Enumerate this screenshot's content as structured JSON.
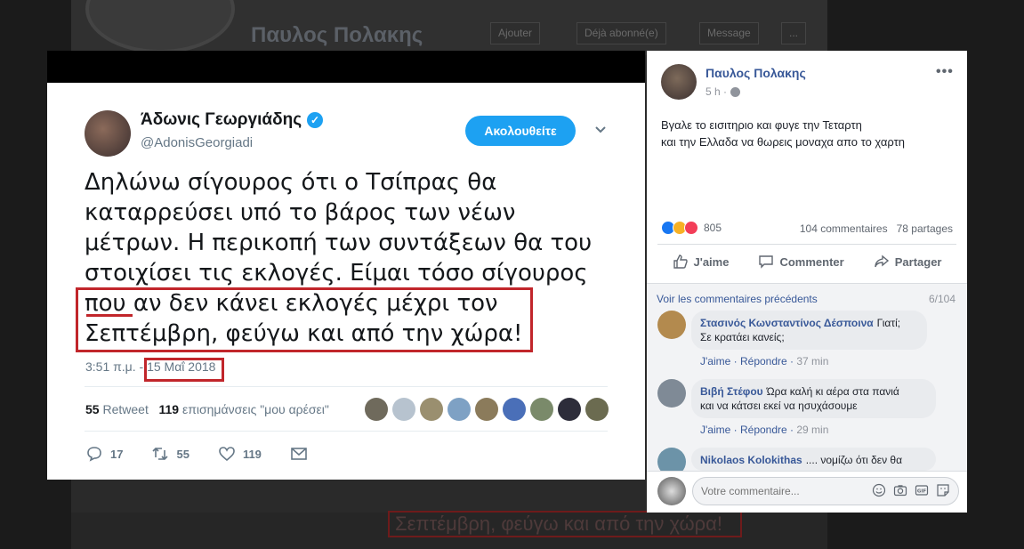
{
  "background": {
    "profile_name": "Παυλος Πολακης",
    "buttons": [
      "Ajouter",
      "Déjà abonné(e)",
      "Message",
      "..."
    ],
    "echo_text": "Σεπτέμβρη, φεύγω και από την χώρα!"
  },
  "tweet": {
    "author_name": "Άδωνις Γεωργιάδης",
    "handle": "@AdonisGeorgiadi",
    "follow_label": "Ακολουθείτε",
    "text_lines": [
      "Δηλώνω σίγουρος ότι ο Τσίπρας θα",
      "καταρρεύσει υπό το βάρος των νέων",
      "μέτρων. Η περικοπή των συντάξεων θα του",
      "στοιχίσει τις εκλογές. Είμαι τόσο σίγουρος",
      "που αν δεν κάνει εκλογές μέχρι τον",
      "Σεπτέμβρη, φεύγω και από την χώρα!"
    ],
    "timestamp": "3:51 π.μ. - 15 Μαΐ 2018",
    "retweets_count": "55",
    "retweets_label": "Retweet",
    "likes_count": "119",
    "likes_label": "επισημάνσεις \"μου αρέσει\"",
    "replies": "17",
    "retweet_action_count": "55",
    "like_action_count": "119"
  },
  "fb": {
    "author": "Παυλος Πολακης",
    "time": "5 h ·",
    "post_lines": [
      "Βγαλε το εισιτηριο και φυγε την Τεταρτη",
      "και την Ελλαδα να θωρεις μοναχα απο το χαρτη"
    ],
    "reaction_count": "805",
    "comments_count": "104 commentaires",
    "shares_count": "78 partages",
    "actions": {
      "like": "J'aime",
      "comment": "Commenter",
      "share": "Partager"
    },
    "view_previous": "Voir les commentaires précédents",
    "comment_position": "6/104",
    "comments": [
      {
        "author": "Στασινός Κωνσταντίνος Δέσποινα",
        "text1": "Γιατί;",
        "text2": "Σε κρατάει κανείς;",
        "like": "J'aime",
        "reply": "Répondre",
        "time": "37 min"
      },
      {
        "author": "Βιβή Στέφου",
        "text1": "Ώρα καλή κι αέρα στα πανιά",
        "text2": "και να κάτσει εκεί να ησυχάσουμε",
        "like": "J'aime",
        "reply": "Répondre",
        "time": "29 min"
      },
      {
        "author": "Nikolaos Kolokithas",
        "text1": ".... νομίζω ότι δεν θα"
      }
    ],
    "composer_placeholder": "Votre commentaire..."
  }
}
